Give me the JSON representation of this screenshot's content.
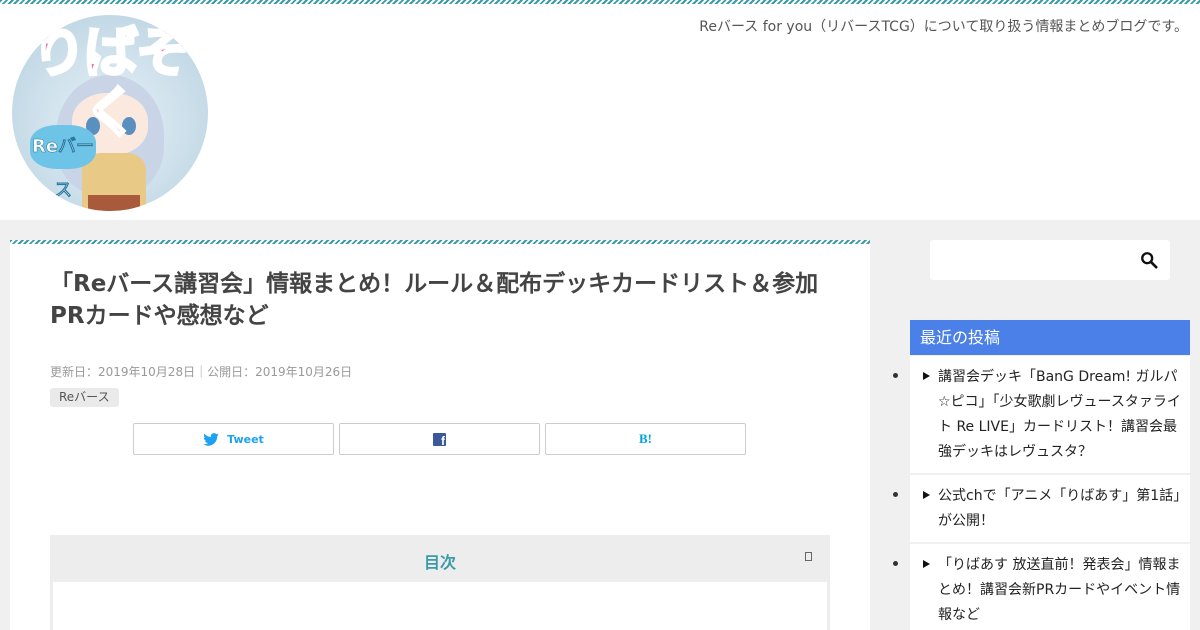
{
  "header": {
    "tagline": "Reバース for you（リバースTCG）について取り扱う情報まとめブログです。",
    "logo": {
      "title": "りばそく",
      "badge": "Reバース",
      "icon": "blog-logo"
    }
  },
  "article": {
    "title": "「Reバース講習会」情報まとめ！ルール＆配布デッキカードリスト＆参加PRカードや感想など",
    "dates": "更新日：2019年10月28日｜公開日：2019年10月26日",
    "category": "Reバース",
    "share": {
      "tweet_label": "Tweet",
      "facebook_icon": "facebook-icon",
      "hatena_label": "B!"
    },
    "toc": {
      "title": "目次"
    }
  },
  "sidebar": {
    "search": {
      "placeholder": ""
    },
    "recent_title": "最近の投稿",
    "posts": [
      {
        "title": "講習会デッキ「BanG Dream! ガルパ☆ピコ」「少女歌劇レヴュースタァライト Re LIVE」カードリスト！講習会最強デッキはレヴュスタ？"
      },
      {
        "title": "公式chで「アニメ「りばあす」第1話」が公開！"
      },
      {
        "title": "「りばあす 放送直前！発表会」情報まとめ！講習会新PRカードやイベント情報など"
      }
    ]
  },
  "colors": {
    "accent": "#3a9aa8",
    "widget_header": "#4a80e8",
    "twitter": "#1da1f2",
    "facebook": "#3b5998",
    "hatena": "#00a4de"
  }
}
